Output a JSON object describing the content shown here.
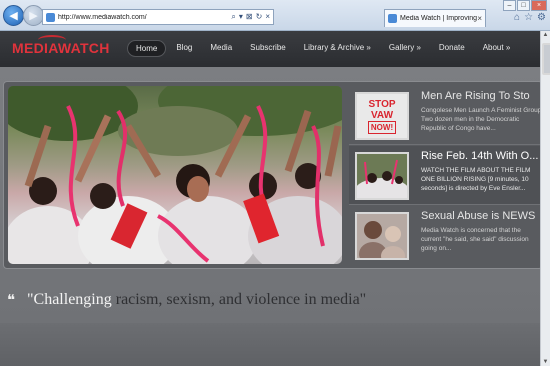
{
  "browser": {
    "address": "http://www.mediawatch.com/",
    "tab_title": "Media Watch | Improving t...",
    "tab_close": "×",
    "back_glyph": "◀",
    "forward_glyph": "▶",
    "address_tools": [
      "⌕",
      "▾",
      "⊠",
      "↻",
      "×"
    ],
    "toolbar_icons": [
      "⌂",
      "☆",
      "⚙"
    ],
    "window_buttons": [
      "–",
      "□",
      "×"
    ]
  },
  "site": {
    "logo": "MEDIAWATCH",
    "nav": [
      {
        "label": "Home",
        "active": true
      },
      {
        "label": "Blog"
      },
      {
        "label": "Media"
      },
      {
        "label": "Subscribe"
      },
      {
        "label": "Library & Archive »"
      },
      {
        "label": "Gallery »"
      },
      {
        "label": "Donate"
      },
      {
        "label": "About »"
      }
    ],
    "slides": [
      {
        "title": "Men Are Rising To Sto",
        "text": "Congolese Men Launch A Feminist Group Two dozen men in the Democratic Republic of Congo have...",
        "thumb_lines": [
          "STOP",
          "VAW",
          "NOW!"
        ]
      },
      {
        "title": "Rise Feb. 14th With O...",
        "text": "WATCH THE FILM ABOUT THE FILM ONE BILLION RISING [9 minutes, 10 seconds] is directed by Eve Ensler..."
      },
      {
        "title": "Sexual Abuse is NEWS",
        "text": "Media Watch is concerned that the current \"he said, she said\" discussion going on..."
      }
    ],
    "tagline_quote": "❝",
    "tagline_lead": "\"Challenging",
    "tagline_rest": " racism, sexism, and violence in media\""
  }
}
